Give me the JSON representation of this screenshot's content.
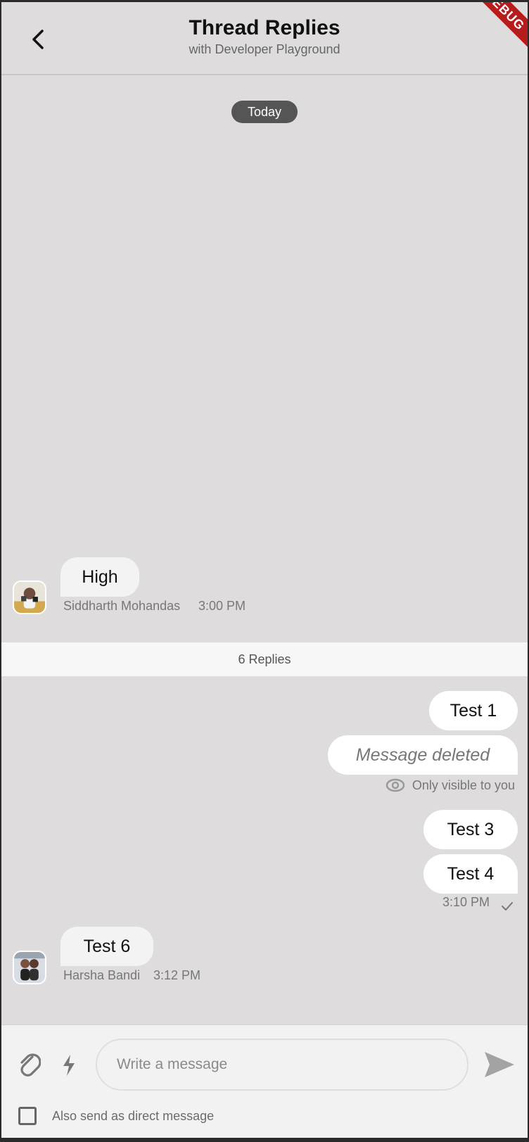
{
  "header": {
    "title": "Thread Replies",
    "subtitle": "with Developer Playground",
    "debug_badge": "DEBUG"
  },
  "thread": {
    "date_separator": "Today",
    "parent_message": {
      "text": "High",
      "author": "Siddharth Mohandas",
      "time": "3:00 PM"
    },
    "replies_count_label": "6 Replies"
  },
  "replies": [
    {
      "text": "Test 1"
    },
    {
      "text": "Message deleted",
      "visibility_note": "Only visible to you"
    },
    {
      "text": "Test 3"
    },
    {
      "text": "Test 4",
      "time": "3:10 PM",
      "status_icon": "check-icon"
    },
    {
      "text": "Test 6",
      "author": "Harsha Bandi",
      "time": "3:12 PM"
    }
  ],
  "composer": {
    "placeholder": "Write a message",
    "value": "",
    "direct_message_label": "Also send as direct message",
    "direct_message_checked": false
  },
  "icons": {
    "back": "chevron-left-icon",
    "attach": "paperclip-icon",
    "commands": "bolt-icon",
    "send": "send-icon",
    "visibility": "eye-icon",
    "status": "check-icon"
  },
  "colors": {
    "screen_background": "#dedcdd",
    "bubble_left": "#f3f3f3",
    "bubble_right": "#ffffff",
    "date_pill": "#555555",
    "debug_ribbon": "#b71c1c"
  }
}
